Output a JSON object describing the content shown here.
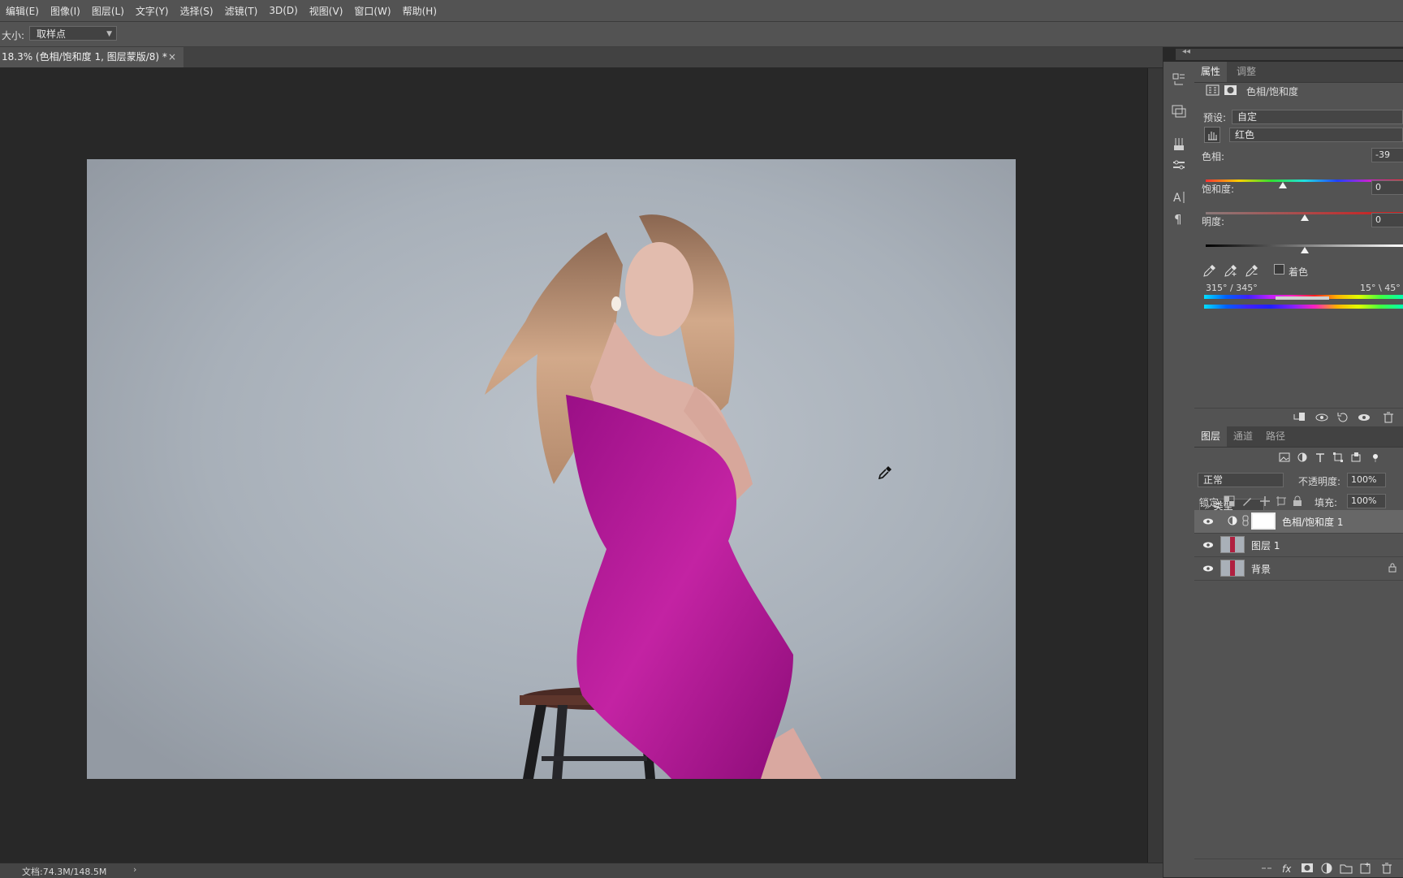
{
  "menubar": {
    "items": [
      "编辑(E)",
      "图像(I)",
      "图层(L)",
      "文字(Y)",
      "选择(S)",
      "滤镜(T)",
      "3D(D)",
      "视图(V)",
      "窗口(W)",
      "帮助(H)"
    ]
  },
  "options": {
    "size_label": "大小:",
    "size_value": "取样点"
  },
  "document": {
    "tab_title": "18.3% (色相/饱和度 1, 图层蒙版/8) *",
    "close_glyph": "×"
  },
  "status": {
    "doc_info": "文档:74.3M/148.5M",
    "arrow": "›"
  },
  "properties_panel": {
    "tabs": [
      "属性",
      "调整"
    ],
    "active_tab": "属性",
    "adjustment_title": "色相/饱和度",
    "preset_label": "预设:",
    "preset_value": "自定",
    "channel_value": "红色",
    "hue_label": "色相:",
    "hue_value": "-39",
    "saturation_label": "饱和度:",
    "saturation_value": "0",
    "lightness_label": "明度:",
    "lightness_value": "0",
    "colorize_label": "着色",
    "range_left": "315° / 345°",
    "range_right": "15° \\ 45°",
    "hue_level": -39,
    "saturation_level": 0,
    "lightness_level": 0
  },
  "layers_panel": {
    "tabs": [
      "图层",
      "通道",
      "路径"
    ],
    "active_tab": "图层",
    "filter_type": "类型",
    "blend_mode": "正常",
    "opacity_label": "不透明度:",
    "opacity_value": "100%",
    "lock_label": "锁定:",
    "fill_label": "填充:",
    "fill_value": "100%",
    "layers": [
      {
        "name": "色相/饱和度 1",
        "kind": "adjustment",
        "visible": true,
        "selected": true
      },
      {
        "name": "图层 1",
        "kind": "pixel",
        "visible": true,
        "selected": false
      },
      {
        "name": "背景",
        "kind": "background",
        "visible": true,
        "selected": false,
        "locked": true
      }
    ]
  },
  "colors": {
    "ui_dark": "#282828",
    "ui_panel": "#535353",
    "dress": "#b0188f",
    "backdrop": "#a7afb8"
  }
}
